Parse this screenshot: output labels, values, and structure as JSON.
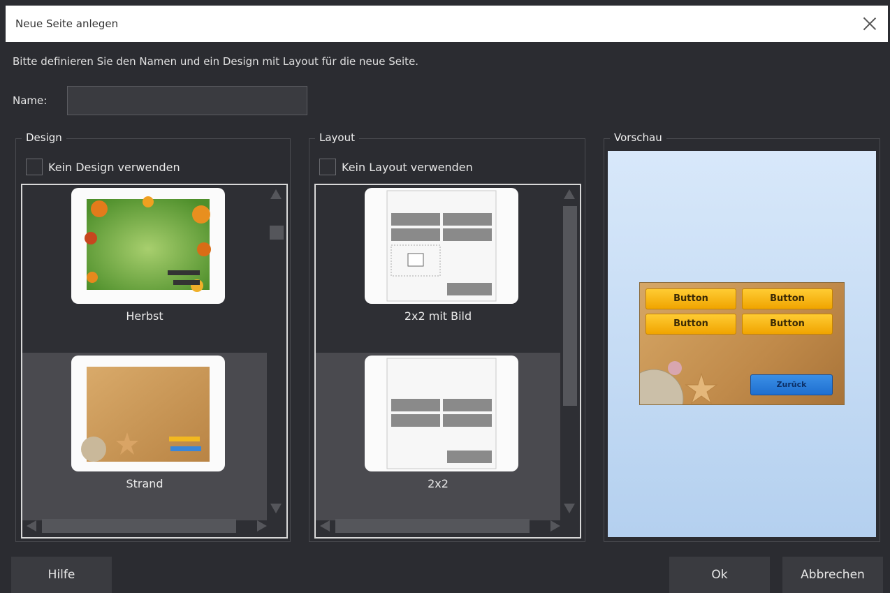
{
  "window": {
    "title": "Neue Seite anlegen"
  },
  "intro_text": "Bitte definieren Sie den Namen und ein Design mit Layout für die neue Seite.",
  "name_field": {
    "label": "Name:",
    "value": ""
  },
  "design": {
    "title": "Design",
    "checkbox_label": "Kein Design verwenden",
    "checked": false,
    "items": [
      {
        "label": "Herbst",
        "selected": false
      },
      {
        "label": "Strand",
        "selected": true
      }
    ]
  },
  "layout": {
    "title": "Layout",
    "checkbox_label": "Kein Layout verwenden",
    "checked": false,
    "items": [
      {
        "label": "2x2 mit Bild",
        "selected": false
      },
      {
        "label": "2x2",
        "selected": true
      }
    ]
  },
  "preview": {
    "title": "Vorschau",
    "buttons": [
      "Button",
      "Button",
      "Button",
      "Button"
    ],
    "back_button": "Zurück"
  },
  "footer": {
    "help_label": "Hilfe",
    "ok_label": "Ok",
    "cancel_label": "Abbrechen"
  }
}
